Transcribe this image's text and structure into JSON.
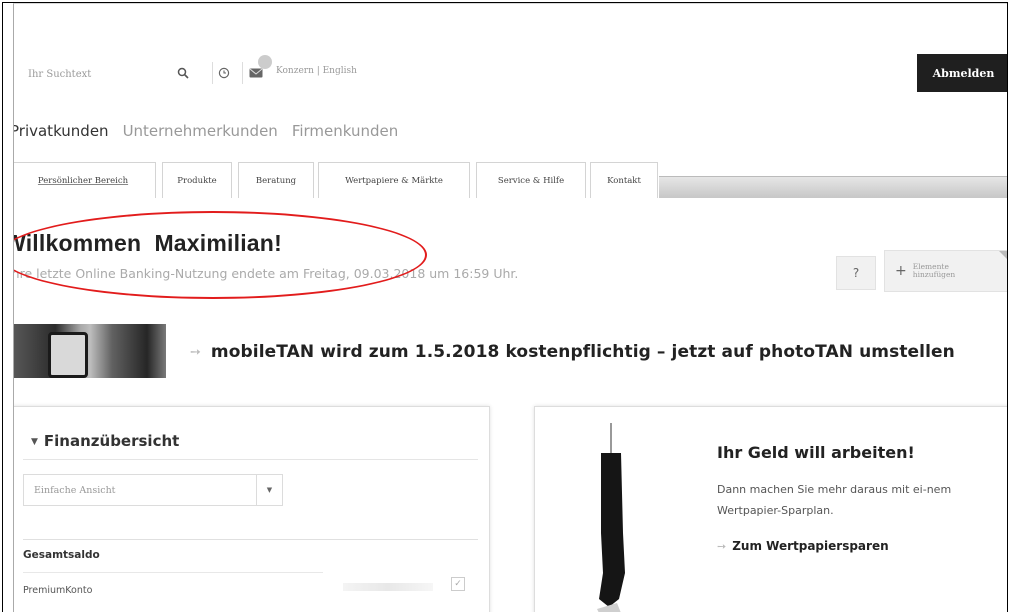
{
  "header": {
    "search_placeholder": "Ihr Suchtext",
    "lang_links": "Konzern | English",
    "logout_label": "Abmelden"
  },
  "segments": [
    "Privatkunden",
    "Unternehmerkunden",
    "Firmenkunden"
  ],
  "tabs": [
    "Persönlicher Bereich",
    "Produkte",
    "Beratung",
    "Wertpapiere & Märkte",
    "Service & Hilfe",
    "Kontakt"
  ],
  "welcome": {
    "greeting": "Willkommen",
    "name": "Maximilian",
    "exclaim": "!",
    "last_login": "Ihre letzte Online Banking-Nutzung endete am Freitag, 09.03.2018 um 16:59 Uhr."
  },
  "actions": {
    "help_label": "?",
    "add_label": "Elemente hinzufügen"
  },
  "banner": {
    "message": "mobileTAN wird zum 1.5.2018 kostenpflichtig – jetzt auf photoTAN umstellen"
  },
  "finance": {
    "title": "Finanzübersicht",
    "view_select": "Einfache Ansicht",
    "total_label": "Gesamtsaldo",
    "account_label": "PremiumKonto"
  },
  "invest": {
    "title": "Ihr Geld will arbeiten!",
    "text": "Dann machen Sie mehr daraus mit ei-nem Wertpapier-Sparplan.",
    "link_label": "Zum Wertpapiersparen"
  },
  "colors": {
    "logout_bg": "#1f1f1f",
    "annotation_red": "#e21c1c"
  }
}
